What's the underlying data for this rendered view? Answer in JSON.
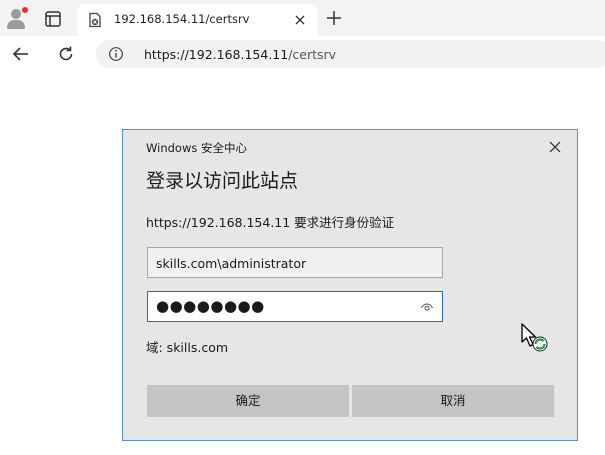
{
  "browser": {
    "tab_title": "192.168.154.11/certsrv",
    "url_host": "https://192.168.154.11",
    "url_path": "/certsrv",
    "icons": [
      "profile-icon",
      "tab-actions-icon",
      "page-favicon-icon",
      "tab-close-icon",
      "new-tab-icon",
      "back-icon",
      "reload-icon",
      "site-info-icon"
    ]
  },
  "dialog": {
    "caption": "Windows 安全中心",
    "heading": "登录以访问此站点",
    "description": "https://192.168.154.11 要求进行身份验证",
    "username_value": "skills.com\\administrator",
    "password_mask": "●●●●●●●●",
    "domain_text": "域: skills.com",
    "ok_label": "确定",
    "cancel_label": "取消"
  },
  "colors": {
    "dialog_bg": "#e6e6e6",
    "dialog_border": "#5a8ec4",
    "focus_border": "#2a6db5",
    "button_bg": "#c4c4c4",
    "profile_dot": "#e0352b"
  }
}
